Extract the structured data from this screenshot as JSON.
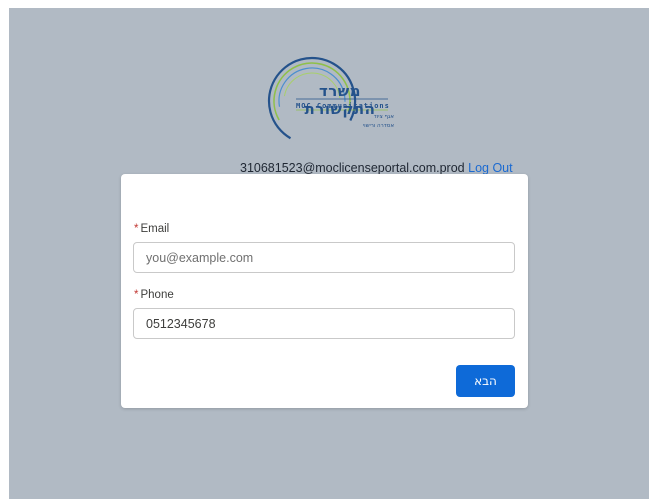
{
  "logo": {
    "hebrew_title": "משרד התקשורת",
    "english_title": "MOC Communications",
    "sub_line_1": "אגף ציוד",
    "sub_line_2": "אסדרה ורישוי"
  },
  "header": {
    "user_email": "310681523@moclicenseportal.com.prod",
    "logout_label": "Log Out"
  },
  "form": {
    "email": {
      "label": "Email",
      "required_mark": "*",
      "placeholder": "you@example.com",
      "value": ""
    },
    "phone": {
      "label": "Phone",
      "required_mark": "*",
      "placeholder": "",
      "value": "0512345678"
    },
    "next_button_label": "הבא"
  },
  "colors": {
    "page_background": "#b1bac4",
    "accent": "#0e6ad8",
    "link": "#1b6ad1",
    "required": "#c23934",
    "logo_blue": "#24528b",
    "logo_green": "#8fc04a"
  },
  "icons": {
    "logo_emblem": "moc-ring-logo-icon"
  }
}
